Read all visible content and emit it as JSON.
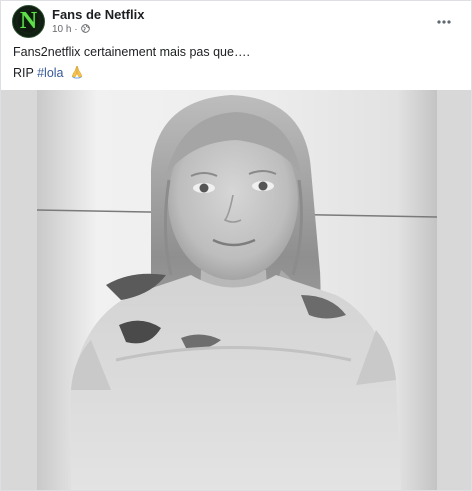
{
  "post": {
    "page_name": "Fans de Netflix",
    "time": "10 h",
    "separator": "·",
    "privacy_icon": "globe-icon",
    "more_icon": "more-options-icon",
    "avatar_letter": "N",
    "text_line1": "Fans2netflix certainement mais pas que….",
    "text_line2_prefix": "RIP ",
    "hashtag": "#lola",
    "emoji_icon": "folded-hands-icon",
    "photo": {
      "description_icon": "portrait-photo",
      "style": "black-and-white"
    }
  },
  "colors": {
    "text_primary": "#1c1e21",
    "text_secondary": "#65676b",
    "link": "#385898",
    "avatar_green": "#5fe04a"
  }
}
